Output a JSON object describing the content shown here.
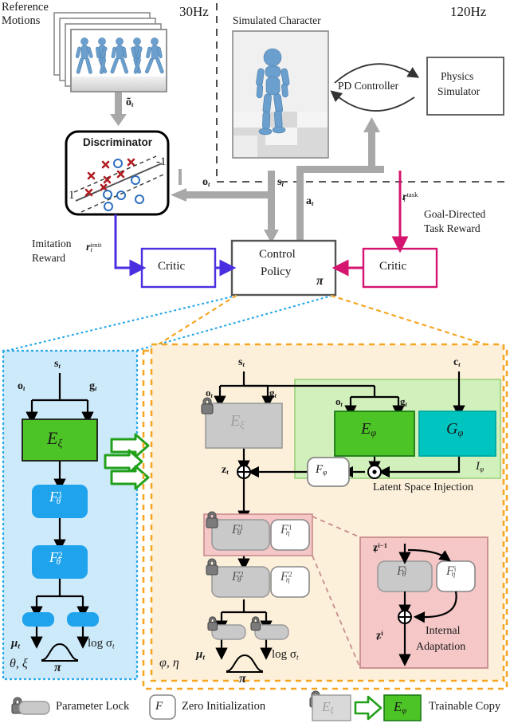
{
  "figure": {
    "title": "Adversarial motion imitation control policy architecture with latent space injection and internal adaptation"
  },
  "colors": {
    "green": "#4dc426",
    "dark_green": "#22a01a",
    "cyan": "#00c4bf",
    "blue_box": "#1fa3ed",
    "light_blue_panel": "#cdeafb",
    "blue_dotted": "#29a8e8",
    "orange_panel": "#fdf0db",
    "orange_dashed": "#f5a623",
    "pink_panel": "#f5c7c7",
    "pink_border": "#c98c8c",
    "light_green_panel": "#d2f0bc",
    "light_green_border": "#a8d98a",
    "critic_imit": "#4a2fe0",
    "critic_task": "#d4146e",
    "gray_arrow": "#a8a8a8",
    "gray_box": "#c9c9c9",
    "lock": "#7b7b7b"
  },
  "top": {
    "reference_motions_line1": "Reference",
    "reference_motions_line2": "Motions",
    "rate_left": "30Hz",
    "rate_right": "120Hz",
    "simulated_character": "Simulated Character",
    "pd_controller": "PD Controller",
    "physics_simulator_line1": "Physics",
    "physics_simulator_line2": "Simulator",
    "discriminator": "Discriminator",
    "disc_pos_label": "1",
    "disc_neg_label": "-1",
    "obs_tilde": "õ",
    "obs_tilde_sub": "t",
    "obs": "o",
    "obs_sub": "t",
    "state": "s",
    "state_sub": "t",
    "action": "a",
    "action_sub": "t"
  },
  "mid": {
    "imitation_reward_line1": "Imitation",
    "imitation_reward_line2": "Reward",
    "r_imit_base": "r",
    "r_imit_sub": "t",
    "r_imit_sup": "imit",
    "r_task_base": "r",
    "r_task_sub": "t",
    "r_task_sup": "task",
    "goal_reward_line1": "Goal-Directed",
    "goal_reward_line2": "Task Reward",
    "critic_left": "Critic",
    "critic_right": "Critic",
    "control_policy_line1": "Control",
    "control_policy_line2": "Policy",
    "policy_symbol": "π"
  },
  "left_panel": {
    "input_state": "s",
    "input_state_sub": "t",
    "obs": "o",
    "obs_sub": "t",
    "goal": "g",
    "goal_sub": "t",
    "encoder": "E",
    "encoder_sub": "ξ",
    "layer1": "F",
    "layer1_sup": "1",
    "layer1_sub": "θ",
    "layer2": "F",
    "layer2_sup": "2",
    "layer2_sub": "θ",
    "mu": "μ",
    "mu_sub": "t",
    "logsigma": "log σ",
    "logsigma_sub": "t",
    "policy_symbol": "π",
    "params": "θ, ξ"
  },
  "right_panel": {
    "input_state": "s",
    "input_state_sub": "t",
    "context": "c",
    "context_sub": "t",
    "obs": "o",
    "obs_sub": "t",
    "goal": "g",
    "goal_sub": "t",
    "frozen_encoder": "E",
    "frozen_encoder_sub": "ξ",
    "trainable_encoder": "E",
    "trainable_encoder_sub": "φ",
    "context_encoder": "G",
    "context_encoder_sub": "φ",
    "zero_init": "F",
    "zero_init_sub": "φ",
    "injection_symbol": "I",
    "injection_symbol_sub": "φ",
    "injection_caption": "Latent Space Injection",
    "latent": "z",
    "latent_sub": "t",
    "layer1_frozen": "F",
    "layer1_frozen_sup": "1",
    "layer1_frozen_sub": "θ",
    "layer1_adapter": "F",
    "layer1_adapter_sup": "1",
    "layer1_adapter_sub": "η",
    "layer2_frozen": "F",
    "layer2_frozen_sup": "2",
    "layer2_frozen_sub": "θ",
    "layer2_adapter": "F",
    "layer2_adapter_sup": "2",
    "layer2_adapter_sub": "η",
    "mu": "μ",
    "mu_sub": "t",
    "logsigma": "log σ",
    "logsigma_sub": "t",
    "policy_symbol": "π",
    "params": "φ, η"
  },
  "adaptation": {
    "input_latent": "z",
    "input_latent_sub": "t",
    "input_latent_sup": "i−1",
    "frozen": "F",
    "frozen_sup": "i",
    "frozen_sub": "θ",
    "adapter": "F",
    "adapter_sup": "i",
    "adapter_sub": "η",
    "output_latent": "z",
    "output_latent_sub": "t",
    "output_latent_sup": "i",
    "caption_line1": "Internal",
    "caption_line2": "Adaptation"
  },
  "legend": {
    "parameter_lock": "Parameter Lock",
    "zero_initialization": "Zero Initialization",
    "zero_init_glyph": "F",
    "trainable_copy": "Trainable Copy",
    "src_box": "E",
    "src_box_sub": "ξ",
    "dst_box": "E",
    "dst_box_sub": "φ"
  }
}
